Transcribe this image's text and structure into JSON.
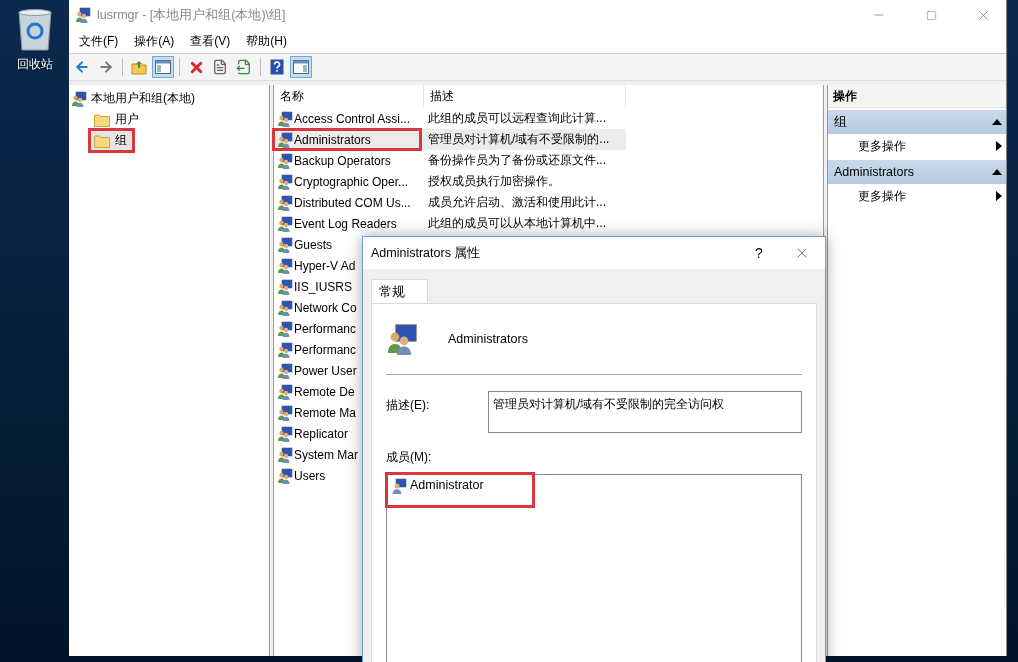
{
  "desktop": {
    "recycle_bin": {
      "label": "回收站"
    }
  },
  "window": {
    "title": "lusrmgr - [本地用户和组(本地)\\组]",
    "menu": [
      "文件(F)",
      "操作(A)",
      "查看(V)",
      "帮助(H)"
    ],
    "toolbar": [
      {
        "kind": "back",
        "pressed": false
      },
      {
        "kind": "forward",
        "pressed": false
      },
      {
        "kind": "separator"
      },
      {
        "kind": "up",
        "pressed": false
      },
      {
        "kind": "tree",
        "pressed": true
      },
      {
        "kind": "separator"
      },
      {
        "kind": "delete",
        "pressed": false
      },
      {
        "kind": "properties",
        "pressed": false
      },
      {
        "kind": "export",
        "pressed": false
      },
      {
        "kind": "separator"
      },
      {
        "kind": "help",
        "pressed": false
      },
      {
        "kind": "pane",
        "pressed": true
      }
    ],
    "tree": {
      "label": "本地用户和组(本地)",
      "children": [
        {
          "label": "用户",
          "selected": false,
          "annotated": false
        },
        {
          "label": "组",
          "selected": true,
          "annotated": true
        }
      ]
    },
    "list": {
      "columns": [
        "名称",
        "描述"
      ],
      "rows": [
        {
          "name": "Access Control Assi...",
          "description": "此组的成员可以远程查询此计算...",
          "selected": false,
          "annotated": false
        },
        {
          "name": "Administrators",
          "description": "管理员对计算机/域有不受限制的...",
          "selected": true,
          "annotated": true
        },
        {
          "name": "Backup Operators",
          "description": "备份操作员为了备份或还原文件...",
          "selected": false,
          "annotated": false
        },
        {
          "name": "Cryptographic Oper...",
          "description": "授权成员执行加密操作。",
          "selected": false,
          "annotated": false
        },
        {
          "name": "Distributed COM Us...",
          "description": "成员允许启动、激活和使用此计...",
          "selected": false,
          "annotated": false
        },
        {
          "name": "Event Log Readers",
          "description": "此组的成员可以从本地计算机中...",
          "selected": false,
          "annotated": false
        },
        {
          "name": "Guests",
          "selected": false,
          "annotated": false
        },
        {
          "name": "Hyper-V Ad",
          "selected": false,
          "annotated": false
        },
        {
          "name": "IIS_IUSRS",
          "selected": false,
          "annotated": false
        },
        {
          "name": "Network Co",
          "selected": false,
          "annotated": false
        },
        {
          "name": "Performanc",
          "selected": false,
          "annotated": false
        },
        {
          "name": "Performanc",
          "selected": false,
          "annotated": false
        },
        {
          "name": "Power User",
          "selected": false,
          "annotated": false
        },
        {
          "name": "Remote De",
          "selected": false,
          "annotated": false
        },
        {
          "name": "Remote Ma",
          "selected": false,
          "annotated": false
        },
        {
          "name": "Replicator",
          "selected": false,
          "annotated": false
        },
        {
          "name": "System Mar",
          "selected": false,
          "annotated": false
        },
        {
          "name": "Users",
          "selected": false,
          "annotated": false
        }
      ]
    },
    "actions": {
      "title": "操作",
      "sections": [
        {
          "title": "组",
          "expanded": true,
          "items": [
            "更多操作"
          ]
        },
        {
          "title": "Administrators",
          "expanded": true,
          "items": [
            "更多操作"
          ]
        }
      ]
    }
  },
  "dialog": {
    "title": "Administrators 属性",
    "help": "?",
    "tabs": [
      {
        "label": "常规",
        "selected": true
      }
    ],
    "group_name": "Administrators",
    "description_label": "描述(E):",
    "description": "管理员对计算机/域有不受限制的完全访问权",
    "members_label": "成员(M):",
    "members": [
      {
        "name": "Administrator",
        "annotated": true
      }
    ]
  }
}
